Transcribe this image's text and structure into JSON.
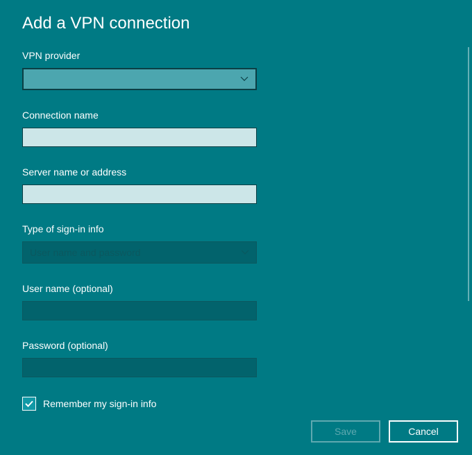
{
  "title": "Add a VPN connection",
  "fields": {
    "provider": {
      "label": "VPN provider",
      "value": ""
    },
    "connectionName": {
      "label": "Connection name",
      "value": ""
    },
    "serverName": {
      "label": "Server name or address",
      "value": ""
    },
    "signInType": {
      "label": "Type of sign-in info",
      "value": "User name and password"
    },
    "userName": {
      "label": "User name (optional)",
      "value": ""
    },
    "password": {
      "label": "Password (optional)",
      "value": ""
    }
  },
  "remember": {
    "label": "Remember my sign-in info",
    "checked": true
  },
  "buttons": {
    "save": "Save",
    "cancel": "Cancel"
  },
  "colors": {
    "background": "#007a84",
    "inputLight": "#cce6e8",
    "inputDisabled": "#02636c",
    "selectActive": "#4ca6af"
  }
}
